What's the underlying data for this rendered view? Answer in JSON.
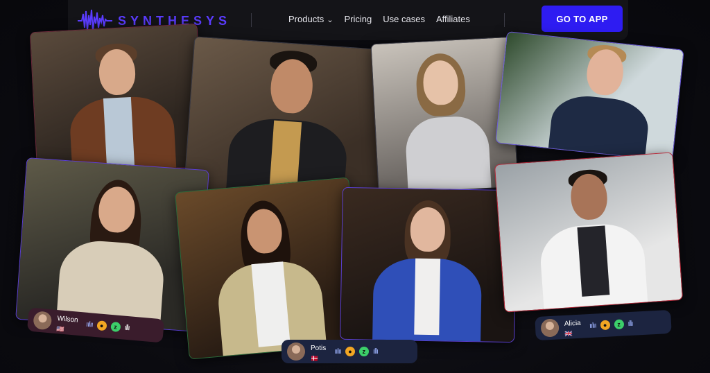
{
  "brand": {
    "name": "SYNTHESYS",
    "accent": "#2e1cf2"
  },
  "nav": {
    "links": [
      {
        "label": "Products",
        "has_dropdown": true
      },
      {
        "label": "Pricing"
      },
      {
        "label": "Use cases"
      },
      {
        "label": "Affiliates"
      }
    ],
    "cta_label": "GO TO APP"
  },
  "speakers": [
    {
      "name": "Wilson",
      "flag": "us-flag-icon",
      "icons": [
        "waveform-icon",
        "coin-icon",
        "z-icon",
        "waveform-icon"
      ]
    },
    {
      "name": "Potis",
      "flag": "dk-flag-icon",
      "icons": [
        "waveform-icon",
        "coin-icon",
        "z-icon",
        "waveform-icon"
      ]
    },
    {
      "name": "Alicia",
      "flag": "uk-flag-icon",
      "icons": [
        "waveform-icon",
        "coin-icon",
        "z-icon",
        "waveform-icon"
      ]
    }
  ]
}
